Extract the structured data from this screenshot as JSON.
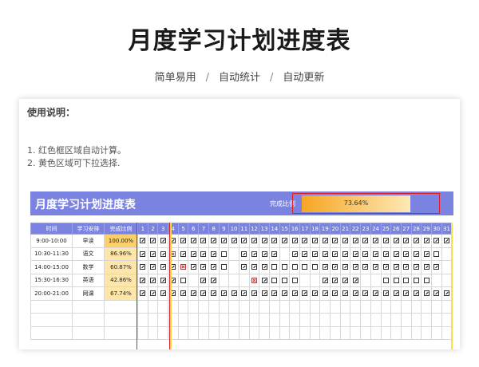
{
  "header": {
    "title": "月度学习计划进度表",
    "subtitle": [
      "简单易用",
      "自动统计",
      "自动更新"
    ],
    "separator": "/"
  },
  "instructions": {
    "title": "使用说明：",
    "lines": [
      "1. 红色框区域自动计算。",
      "2. 黄色区域可下拉选择."
    ]
  },
  "banner": {
    "title": "月度学习计划进度表",
    "progress_label": "完成比例",
    "progress_value": "73.64%",
    "progress": 0.7364
  },
  "table": {
    "columns": [
      "时间",
      "学习安排",
      "完成比例"
    ],
    "days": [
      "1",
      "2",
      "3",
      "4",
      "5",
      "6",
      "7",
      "8",
      "9",
      "10",
      "11",
      "12",
      "13",
      "14",
      "15",
      "16",
      "17",
      "18",
      "19",
      "20",
      "21",
      "22",
      "23",
      "24",
      "25",
      "26",
      "27",
      "28",
      "29",
      "30",
      "31"
    ],
    "rows": [
      {
        "time": "9:00-10:00",
        "task": "早读",
        "pct": "100.00%",
        "marks": "ccccccccccccccccccccccccccccccc"
      },
      {
        "time": "10:30-11:30",
        "task": "语文",
        "pct": "86.96%",
        "marks": "cccxcccce cccc ccccccccccccccu"
      },
      {
        "time": "14:00-15:00",
        "task": "数学",
        "pct": "60.87%",
        "marks": "ccccxcccu cccueeeucccccccccccc"
      },
      {
        "time": "15:30-16:30",
        "task": "英语",
        "pct": "42.86%",
        "marks": "cccce cc   xcuuu  cccc  uuuuu "
      },
      {
        "time": "20:00-21:00",
        "task": "网课",
        "pct": "67.74%",
        "marks": "ccccccccccccccccccccccccccccccc"
      }
    ],
    "empty_rows": 3
  },
  "colors": {
    "accent": "#7b83e0",
    "highlight": "#e02020",
    "fill": "#fde6a8"
  }
}
